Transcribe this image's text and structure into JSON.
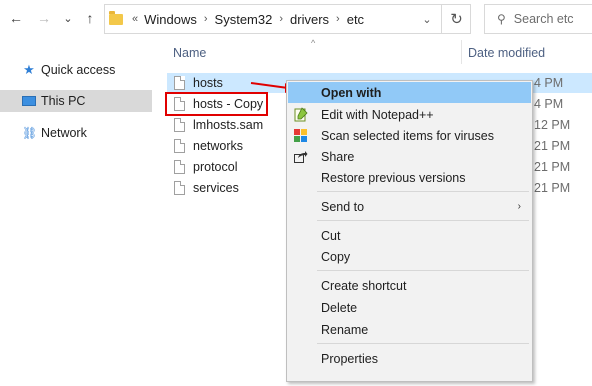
{
  "toolbar": {
    "back_glyph": "←",
    "forward_glyph": "→",
    "recent_glyph": "⌄",
    "up_glyph": "↑"
  },
  "address": {
    "overflow": "«",
    "crumbs": [
      "Windows",
      "System32",
      "drivers",
      "etc"
    ],
    "separator": "›",
    "dropdown_glyph": "⌄",
    "refresh_glyph": "↻"
  },
  "search": {
    "placeholder": "Search etc",
    "icon": "search-icon"
  },
  "nav": {
    "items": [
      {
        "label": "Quick access",
        "icon": "star-icon"
      },
      {
        "label": "This PC",
        "icon": "computer-icon",
        "selected": true
      },
      {
        "label": "Network",
        "icon": "network-icon"
      }
    ]
  },
  "columns": {
    "name": "Name",
    "date": "Date modified"
  },
  "files": [
    {
      "name": "hosts",
      "date": "4 PM"
    },
    {
      "name": "hosts - Copy",
      "date": "4 PM"
    },
    {
      "name": "lmhosts.sam",
      "date": "12 PM"
    },
    {
      "name": "networks",
      "date": "21 PM"
    },
    {
      "name": "protocol",
      "date": "21 PM"
    },
    {
      "name": "services",
      "date": "21 PM"
    }
  ],
  "context_menu": {
    "items": [
      {
        "label": "Open with",
        "bold": true,
        "highlighted": true
      },
      {
        "label": "Edit with Notepad++",
        "icon": "notepadplusplus-icon"
      },
      {
        "label": "Scan selected items for viruses",
        "icon": "antivirus-icon"
      },
      {
        "label": "Share",
        "icon": "share-icon"
      },
      {
        "label": "Restore previous versions"
      },
      {
        "label": "Send to",
        "submenu": "›"
      },
      {
        "label": "Cut"
      },
      {
        "label": "Copy"
      },
      {
        "label": "Create shortcut"
      },
      {
        "label": "Delete"
      },
      {
        "label": "Rename"
      },
      {
        "label": "Properties"
      }
    ]
  },
  "colors": {
    "highlight": "#91c9f7",
    "selection": "#cce8ff",
    "annotation": "#e00000"
  }
}
